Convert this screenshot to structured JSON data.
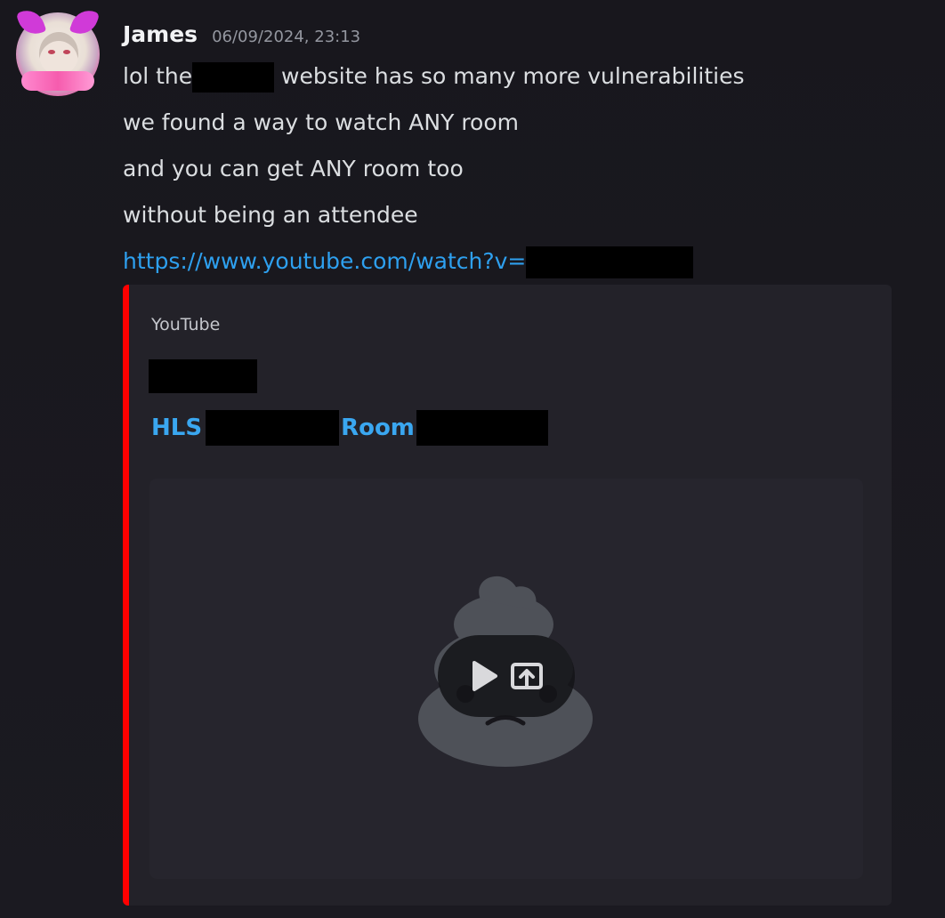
{
  "message": {
    "author": "James",
    "timestamp": "06/09/2024, 23:13",
    "lines": {
      "l1_pre": "lol the ",
      "l1_post": " website has so many more vulnerabilities",
      "l2": "we found a way to watch ANY room",
      "l3": "and you can get ANY room too",
      "l4": "without being an attendee",
      "link": "https://www.youtube.com/watch?v="
    }
  },
  "embed": {
    "provider": "YouTube",
    "title_part1": "HLS",
    "title_part2": "Room",
    "accent_color": "#ff0000",
    "link_color": "#2ea0ef"
  },
  "icons": {
    "avatar": "anime-avatar",
    "placeholder": "poop-emoji-icon",
    "play": "play-icon",
    "open": "open-external-icon"
  }
}
